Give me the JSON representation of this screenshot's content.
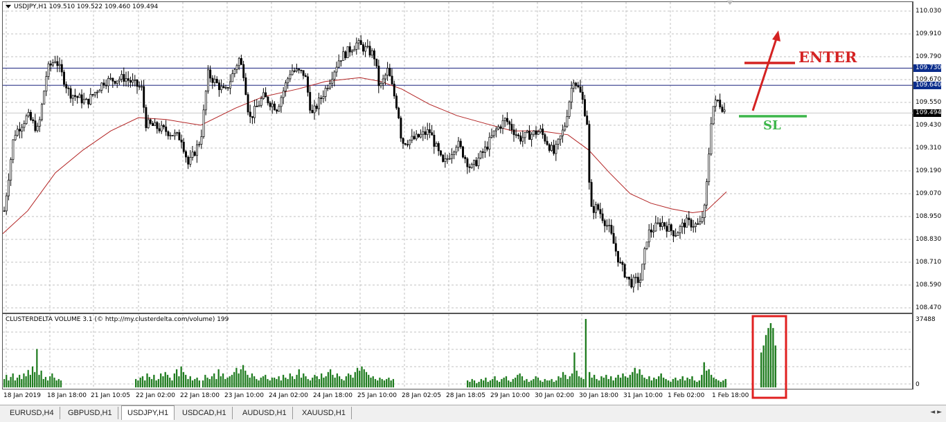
{
  "window": {
    "symbol_line": "USDJPY,H1  109.510 109.522 109.460 109.494",
    "indicator_line": "CLUSTERDELTA VOLUME 3.1 (© http://my.clusterdelta.com/volume) 199"
  },
  "price_axis": {
    "labels": [
      "110.030",
      "109.910",
      "109.790",
      "109.670",
      "109.550",
      "109.430",
      "109.310",
      "109.190",
      "109.070",
      "108.950",
      "108.830",
      "108.710",
      "108.590",
      "108.470"
    ],
    "highlighted": [
      {
        "text": "109.730",
        "bg": "#0b2d8c",
        "fg": "#ffffff"
      },
      {
        "text": "109.640",
        "bg": "#0b2d8c",
        "fg": "#ffffff"
      },
      {
        "text": "109.494",
        "bg": "#000000",
        "fg": "#ffffff"
      }
    ]
  },
  "volume_axis": {
    "max_label": "37488",
    "zero_label": "0"
  },
  "time_axis": {
    "labels": [
      "18 Jan 2019",
      "18 Jan 18:00",
      "21 Jan 10:05",
      "22 Jan 02:00",
      "22 Jan 18:00",
      "23 Jan 10:00",
      "24 Jan 02:00",
      "24 Jan 18:00",
      "25 Jan 10:00",
      "28 Jan 02:05",
      "28 Jan 18:05",
      "29 Jan 10:00",
      "30 Jan 02:00",
      "30 Jan 18:00",
      "31 Jan 10:00",
      "1 Feb 02:00",
      "1 Feb 18:00"
    ]
  },
  "annotations": {
    "enter_label": "ENTER",
    "sl_label": "SL",
    "enter_color": "#d42222",
    "sl_color": "#3cb64a"
  },
  "colors": {
    "candle": "#000000",
    "ma": "#b22222",
    "volume": "#1e7b1e",
    "grid": "#c0c0c0",
    "hline": "#1a237e"
  },
  "tabs": [
    {
      "label": "EURUSD,H4",
      "active": false
    },
    {
      "label": "GBPUSD,H1",
      "active": false
    },
    {
      "label": "USDJPY,H1",
      "active": true
    },
    {
      "label": "USDCAD,H1",
      "active": false
    },
    {
      "label": "AUDUSD,H1",
      "active": false
    },
    {
      "label": "XAUUSD,H1",
      "active": false
    }
  ]
}
